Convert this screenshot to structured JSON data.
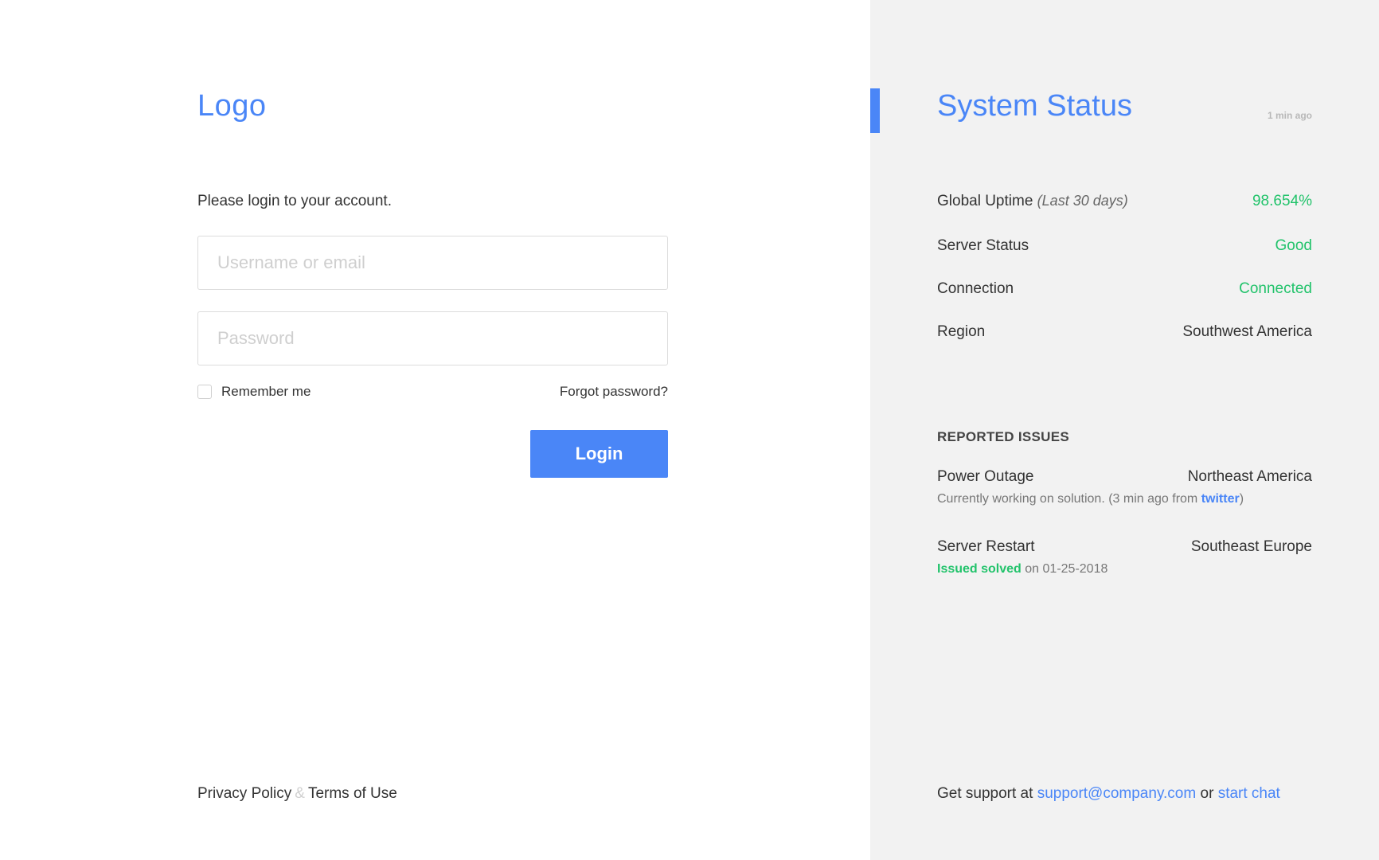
{
  "login": {
    "logo": "Logo",
    "subtitle": "Please login to your account.",
    "username_placeholder": "Username or email",
    "password_placeholder": "Password",
    "remember_label": "Remember me",
    "remember_checked": false,
    "forgot_label": "Forgot password?",
    "login_button": "Login",
    "footer": {
      "privacy": "Privacy Policy",
      "separator": "&",
      "terms": "Terms of Use"
    }
  },
  "status": {
    "title": "System Status",
    "updated": "1 min ago",
    "rows": [
      {
        "label": "Global Uptime",
        "label_note": "(Last 30 days)",
        "value": "98.654%",
        "value_color": "#22c36b"
      },
      {
        "label": "Server Status",
        "value": "Good",
        "value_color": "#22c36b"
      },
      {
        "label": "Connection",
        "value": "Connected",
        "value_color": "#22c36b"
      },
      {
        "label": "Region",
        "value": "Southwest America",
        "value_color": "#333333"
      }
    ],
    "issues_heading": "REPORTED ISSUES",
    "issues": [
      {
        "title": "Power Outage",
        "region": "Northeast America",
        "note_prefix": "Currently working on solution. (3 min ago from",
        "note_link": "twitter",
        "note_suffix": ")"
      },
      {
        "title": "Server Restart",
        "region": "Southeast Europe",
        "note_status": "Issued solved",
        "note_date": "on 01-25-2018"
      }
    ],
    "support": {
      "prefix": "Get support at",
      "email": "support@company.com",
      "or": "or",
      "chat": "start chat"
    }
  },
  "colors": {
    "accent": "#4a86f7",
    "success": "#22c36b",
    "right_panel_bg": "#f2f2f2"
  }
}
